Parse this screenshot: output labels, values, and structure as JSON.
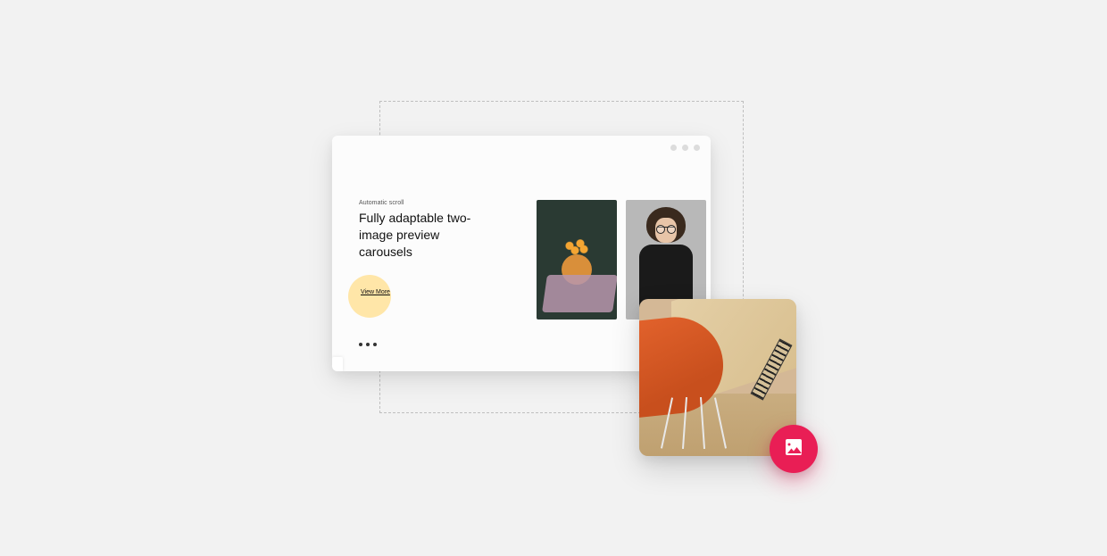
{
  "carousel": {
    "eyebrow": "Automatic scroll",
    "headline": "Fully adaptable two-image preview carousels",
    "cta": "View More"
  },
  "colors": {
    "accent_circle": "#ffe6a8",
    "fab": "#e91e55"
  }
}
